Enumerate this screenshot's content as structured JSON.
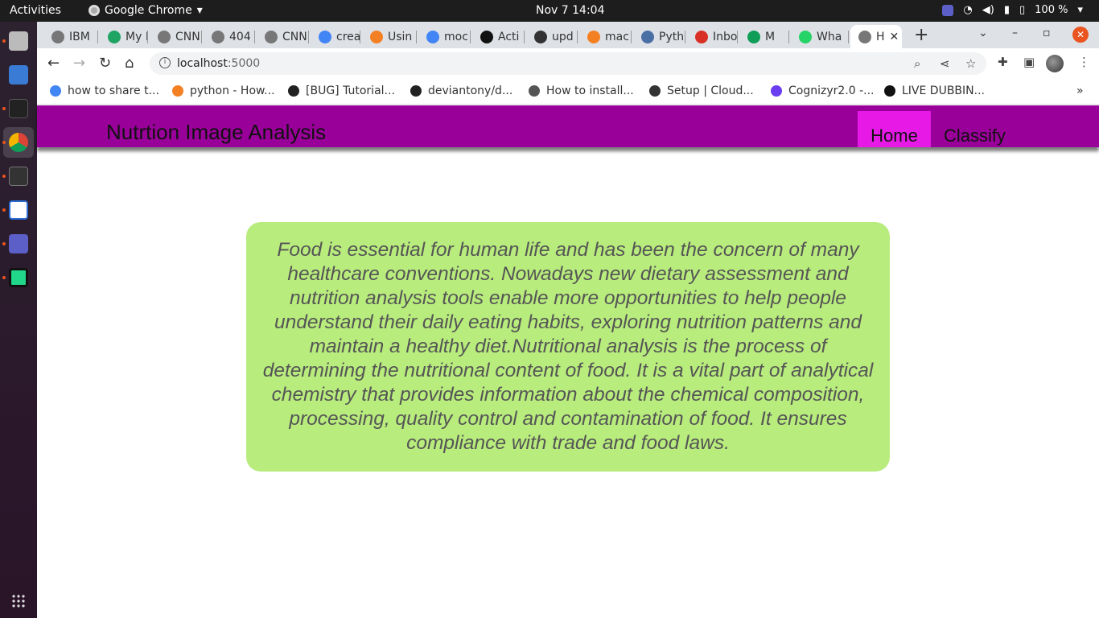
{
  "system": {
    "activities": "Activities",
    "app_name": "Google Chrome",
    "clock": "Nov 7  14:04",
    "battery": "100 %"
  },
  "browser": {
    "tabs": [
      {
        "label": "IBM",
        "color": "#777"
      },
      {
        "label": "My D",
        "color": "#1fa463"
      },
      {
        "label": "CNN",
        "color": "#777"
      },
      {
        "label": "404",
        "color": "#777"
      },
      {
        "label": "CNN",
        "color": "#777"
      },
      {
        "label": "crea",
        "color": "#4285f4"
      },
      {
        "label": "Usin",
        "color": "#f48024"
      },
      {
        "label": "moc",
        "color": "#4285f4"
      },
      {
        "label": "Acti",
        "color": "#111"
      },
      {
        "label": "upd",
        "color": "#333"
      },
      {
        "label": "mac",
        "color": "#f48024"
      },
      {
        "label": "Pyth",
        "color": "#4a6fa5"
      },
      {
        "label": "Inbo",
        "color": "#d93025"
      },
      {
        "label": "M",
        "color": "#0f9d58"
      },
      {
        "label": "Wha",
        "color": "#25d366"
      },
      {
        "label": "H",
        "color": "#777",
        "active": true
      }
    ],
    "address": {
      "host": "localhost",
      "port": ":5000"
    },
    "bookmarks": [
      {
        "label": "how to share t...",
        "color": "#4285f4"
      },
      {
        "label": "python - How...",
        "color": "#f48024"
      },
      {
        "label": "[BUG] Tutorial...",
        "color": "#222"
      },
      {
        "label": "deviantony/d...",
        "color": "#222"
      },
      {
        "label": "How to install...",
        "color": "#555"
      },
      {
        "label": "Setup | Cloud...",
        "color": "#333"
      },
      {
        "label": "Cognizyr2.0 -...",
        "color": "#6a3df0"
      },
      {
        "label": "LIVE DUBBIN...",
        "color": "#111"
      }
    ]
  },
  "site": {
    "title": "Nutrtion Image Analysis",
    "nav": {
      "home": "Home",
      "classify": "Classify"
    },
    "intro": "Food is essential for human life and has been the concern of many healthcare conventions. Nowadays new dietary assessment and nutrition analysis tools enable more opportunities to help people understand their daily eating habits, exploring nutrition patterns and maintain a healthy diet.Nutritional analysis is the process of determining the nutritional content of food. It is a vital part of analytical chemistry that provides information about the chemical composition, processing, quality control and contamination of food. It ensures compliance with trade and food laws.",
    "colors": {
      "header": "#990099",
      "active_nav": "#e619e6",
      "card": "#b8ec7d"
    }
  }
}
